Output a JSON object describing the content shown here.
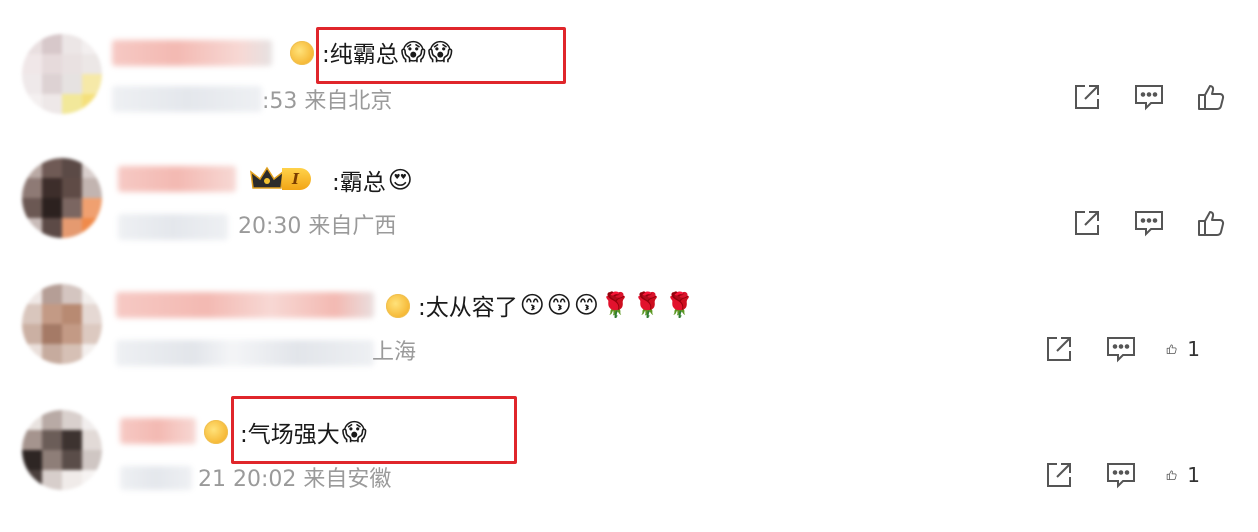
{
  "comments": [
    {
      "text": ":纯霸总",
      "emojis": [
        "😱",
        "😱"
      ],
      "meta": ":53 来自北京",
      "likes": ""
    },
    {
      "text": ":霸总",
      "emojis": [
        "😍"
      ],
      "meta": "20:30 来自广西",
      "badge_level": "I",
      "likes": ""
    },
    {
      "text": ":太从容了",
      "emojis": [
        "😙",
        "😙",
        "😙",
        "🌹",
        "🌹",
        "🌹"
      ],
      "meta": "上海",
      "likes": "1"
    },
    {
      "text": ":气场强大",
      "emojis": [
        "😱"
      ],
      "meta": "21 20:02 来自安徽",
      "likes": "1"
    }
  ],
  "icons": {
    "repost": "share-box-icon",
    "comment": "comment-bubble-icon",
    "like": "thumbs-up-icon"
  },
  "colors": {
    "highlight_box": "#e0262b",
    "meta_text": "#9a9a9a",
    "icon": "#555555"
  }
}
